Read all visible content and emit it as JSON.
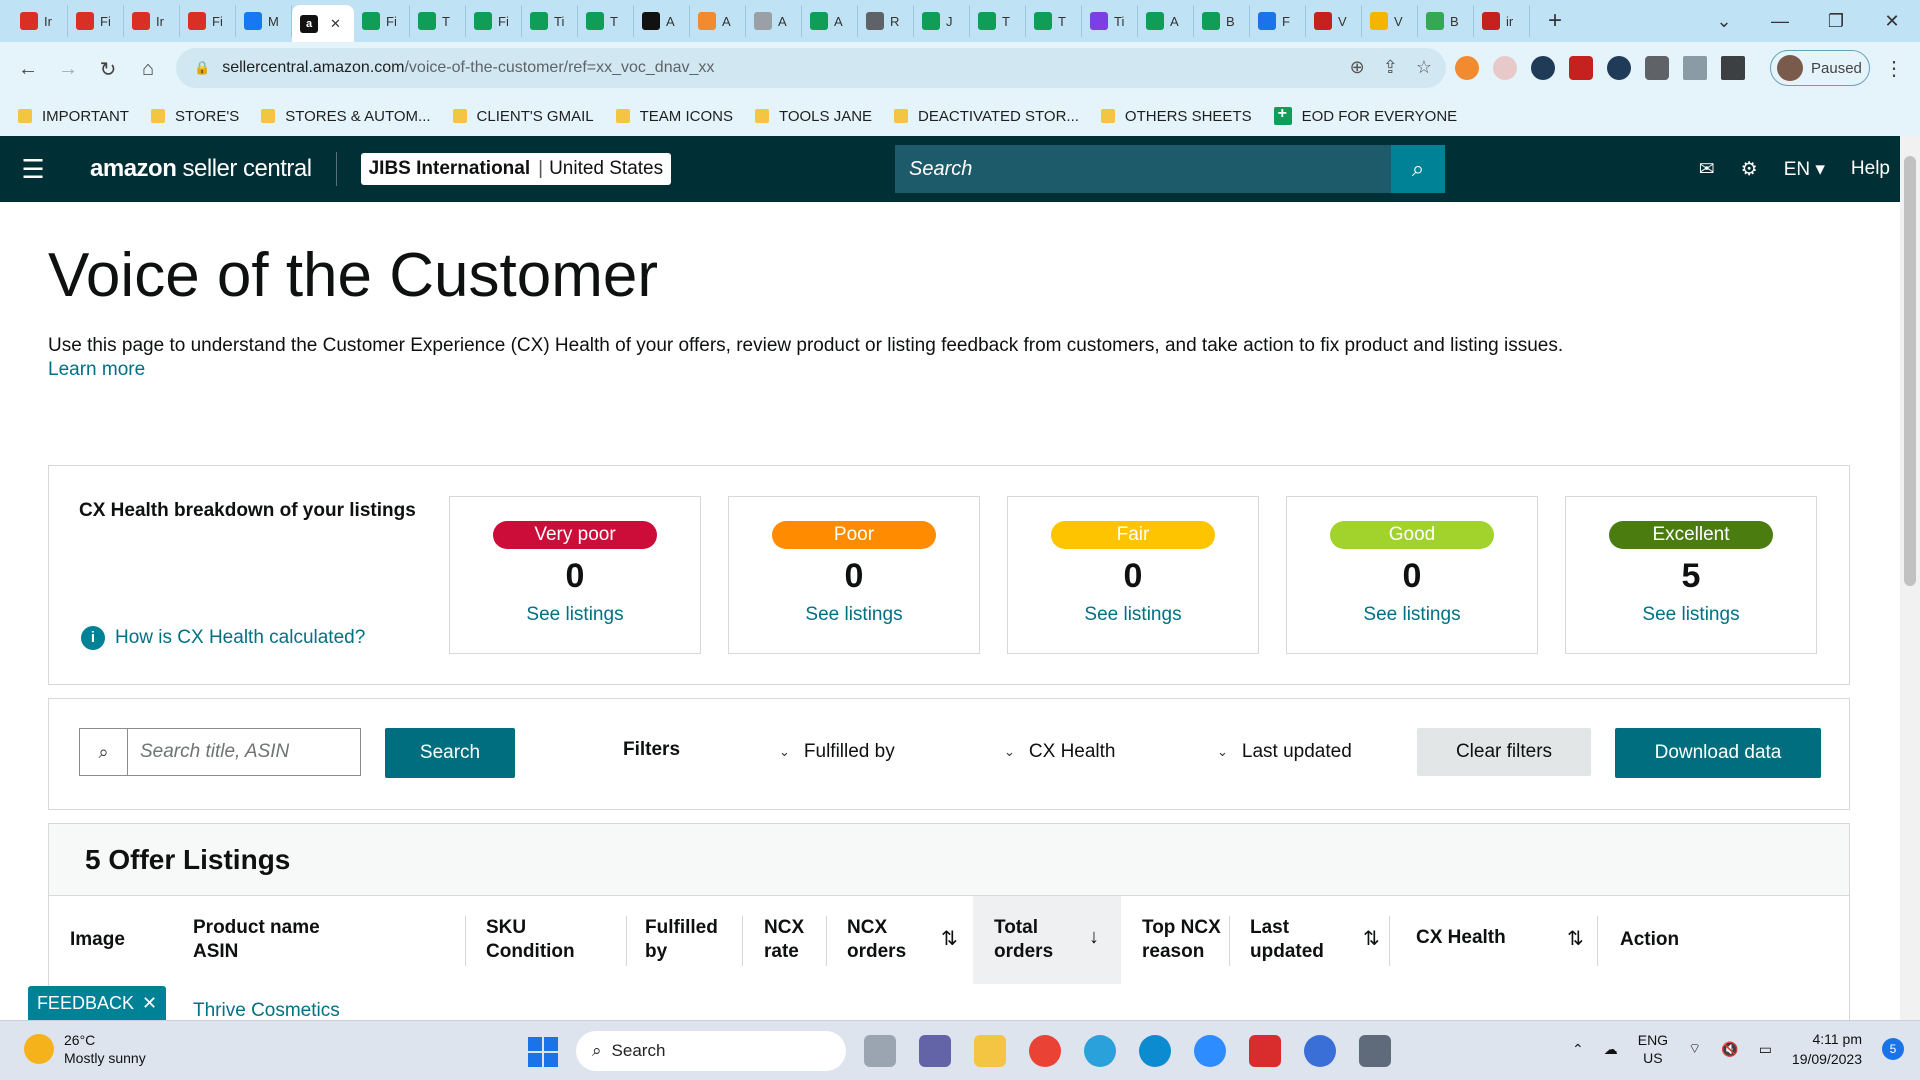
{
  "browser": {
    "tabs": [
      {
        "label": "Ir",
        "color": "#d93025"
      },
      {
        "label": "Fi",
        "color": "#d93025"
      },
      {
        "label": "Ir",
        "color": "#d93025"
      },
      {
        "label": "Fi",
        "color": "#d93025"
      },
      {
        "label": "M",
        "color": "#1877f2"
      },
      {
        "label": "",
        "color": "#111111",
        "active": true
      },
      {
        "label": "Fi",
        "color": "#0f9d58"
      },
      {
        "label": "T",
        "color": "#0f9d58"
      },
      {
        "label": "Fi",
        "color": "#0f9d58"
      },
      {
        "label": "Ti",
        "color": "#0f9d58"
      },
      {
        "label": "T",
        "color": "#0f9d58"
      },
      {
        "label": "A",
        "color": "#111111"
      },
      {
        "label": "A",
        "color": "#f28b30"
      },
      {
        "label": "A",
        "color": "#9aa0a6"
      },
      {
        "label": "A",
        "color": "#0f9d58"
      },
      {
        "label": "R",
        "color": "#5f6368"
      },
      {
        "label": "J",
        "color": "#0f9d58"
      },
      {
        "label": "T",
        "color": "#0f9d58"
      },
      {
        "label": "T",
        "color": "#0f9d58"
      },
      {
        "label": "Ti",
        "color": "#7b3fe4"
      },
      {
        "label": "A",
        "color": "#0f9d58"
      },
      {
        "label": "B",
        "color": "#0f9d58"
      },
      {
        "label": "F",
        "color": "#1a73e8"
      },
      {
        "label": "V",
        "color": "#c5221f"
      },
      {
        "label": "V",
        "color": "#f4b400"
      },
      {
        "label": "B",
        "color": "#34a853"
      },
      {
        "label": "ir",
        "color": "#c5221f"
      }
    ],
    "url_host": "sellercentral.amazon.com",
    "url_path": "/voice-of-the-customer/ref=xx_voc_dnav_xx",
    "profile_status": "Paused",
    "bookmarks": [
      {
        "label": "IMPORTANT",
        "type": "folder"
      },
      {
        "label": "STORE'S",
        "type": "folder"
      },
      {
        "label": "STORES & AUTOM...",
        "type": "folder"
      },
      {
        "label": "CLIENT'S GMAIL",
        "type": "folder"
      },
      {
        "label": "TEAM ICONS",
        "type": "folder"
      },
      {
        "label": "TOOLS JANE",
        "type": "folder"
      },
      {
        "label": "DEACTIVATED STOR...",
        "type": "folder"
      },
      {
        "label": "OTHERS SHEETS",
        "type": "folder"
      },
      {
        "label": "EOD FOR EVERYONE",
        "type": "sheet"
      }
    ]
  },
  "header": {
    "logo_bold": "amazon",
    "logo_light": "seller central",
    "account_name": "JIBS International",
    "account_region": "United States",
    "search_placeholder": "Search",
    "language": "EN",
    "help": "Help"
  },
  "page": {
    "title": "Voice of the Customer",
    "intro": "Use this page to understand the Customer Experience (CX) Health of your offers, review product or listing feedback from customers, and take action to fix product and listing issues.",
    "learn_more": "Learn more"
  },
  "cx_health": {
    "title": "CX Health breakdown of your listings",
    "help_link": "How is CX Health calculated?",
    "cards": [
      {
        "label": "Very poor",
        "count": "0",
        "link": "See listings",
        "color": "#cc0c39"
      },
      {
        "label": "Poor",
        "count": "0",
        "link": "See listings",
        "color": "#ff8c00"
      },
      {
        "label": "Fair",
        "count": "0",
        "link": "See listings",
        "color": "#ffc400"
      },
      {
        "label": "Good",
        "count": "0",
        "link": "See listings",
        "color": "#a1d32c"
      },
      {
        "label": "Excellent",
        "count": "5",
        "link": "See listings",
        "color": "#4b7c0f"
      }
    ]
  },
  "filters": {
    "search_placeholder": "Search title, ASIN",
    "search_button": "Search",
    "filters_label": "Filters",
    "fulfilled_by": "Fulfilled by",
    "cx_health": "CX Health",
    "last_updated": "Last updated",
    "clear_filters": "Clear filters",
    "download_data": "Download data"
  },
  "listings": {
    "heading": "5 Offer Listings",
    "columns": {
      "image": "Image",
      "product_l1": "Product name",
      "product_l2": "ASIN",
      "sku_l1": "SKU",
      "sku_l2": "Condition",
      "fulfilled_l1": "Fulfilled",
      "fulfilled_l2": "by",
      "ncx_rate_l1": "NCX",
      "ncx_rate_l2": "rate",
      "ncx_orders_l1": "NCX",
      "ncx_orders_l2": "orders",
      "total_l1": "Total",
      "total_l2": "orders",
      "reason_l1": "Top NCX",
      "reason_l2": "reason",
      "updated_l1": "Last",
      "updated_l2": "updated",
      "cx_health": "CX Health",
      "action": "Action"
    },
    "first_row_product": "Thrive Cosmetics"
  },
  "feedback": "FEEDBACK",
  "taskbar": {
    "temperature": "26°C",
    "weather": "Mostly sunny",
    "search": "Search",
    "lang_l1": "ENG",
    "lang_l2": "US",
    "time": "4:11 pm",
    "date": "19/09/2023",
    "notifications": "5"
  }
}
